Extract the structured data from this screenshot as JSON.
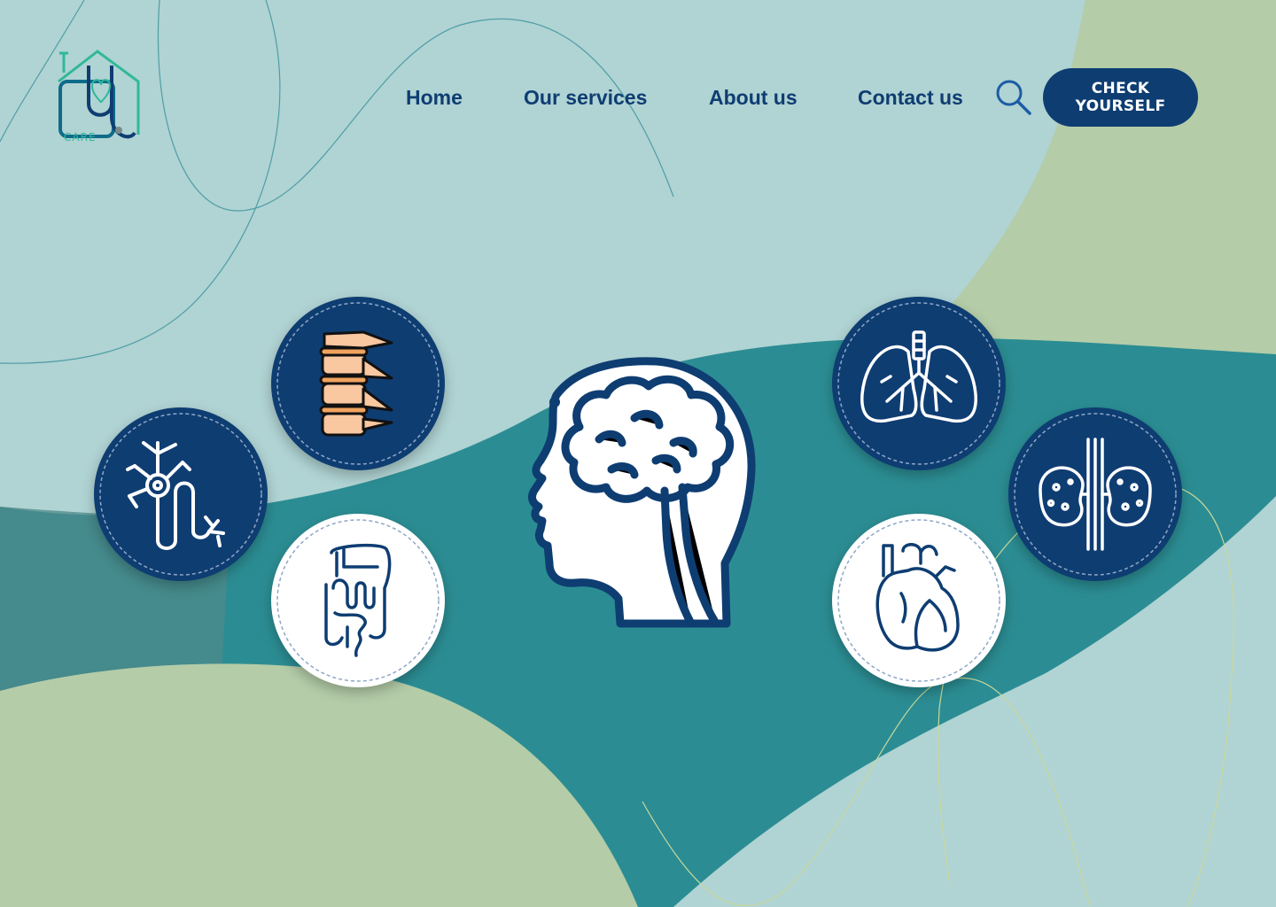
{
  "brand": {
    "logo_text": "CARE"
  },
  "nav": {
    "items": [
      {
        "label": "Home"
      },
      {
        "label": "Our services"
      },
      {
        "label": "About us"
      },
      {
        "label": "Contact us"
      }
    ]
  },
  "search": {
    "icon": "search-icon"
  },
  "cta": {
    "label": "CHECK YOURSELF"
  },
  "hero": {
    "center_icon": "head-brain-icon",
    "organs": [
      {
        "icon": "spine-icon",
        "style": "dark"
      },
      {
        "icon": "nerve-cell-icon",
        "style": "dark"
      },
      {
        "icon": "intestines-icon",
        "style": "light"
      },
      {
        "icon": "lungs-icon",
        "style": "dark"
      },
      {
        "icon": "kidneys-icon",
        "style": "dark"
      },
      {
        "icon": "heart-icon",
        "style": "light"
      }
    ]
  },
  "colors": {
    "navy": "#0e3d72",
    "light_teal": "#b0d3d3",
    "sage": "#b4cca8",
    "teal": "#2b8d93",
    "accent_green": "#2fb89a"
  }
}
